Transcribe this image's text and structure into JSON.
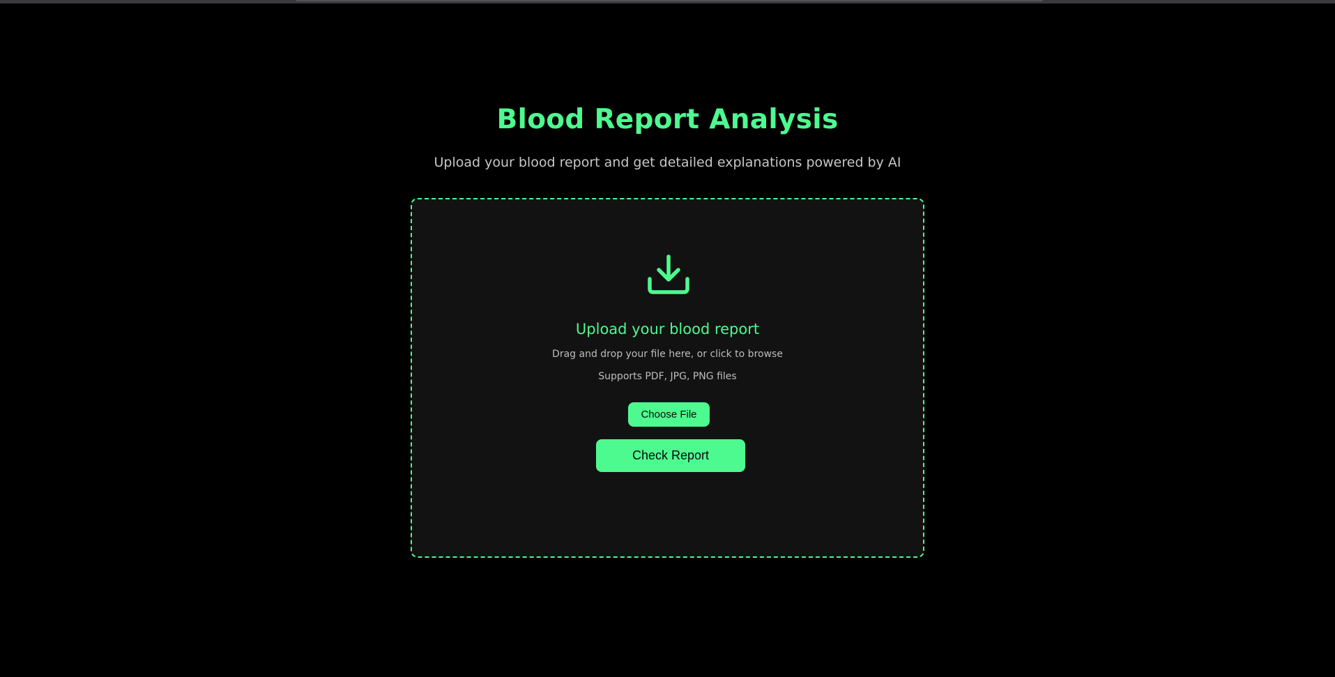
{
  "header": {
    "title": "Blood Report Analysis",
    "subtitle": "Upload your blood report and get detailed explanations powered by AI"
  },
  "upload": {
    "icon": "download-tray-icon",
    "heading": "Upload your blood report",
    "hint": "Drag and drop your file here, or click to browse",
    "formats": "Supports PDF, JPG, PNG files",
    "choose_file_label": "Choose File",
    "check_report_label": "Check Report"
  },
  "colors": {
    "accent": "#4dfa8f",
    "background": "#000000",
    "panel": "#121212",
    "muted_text": "#c7c7c7"
  }
}
